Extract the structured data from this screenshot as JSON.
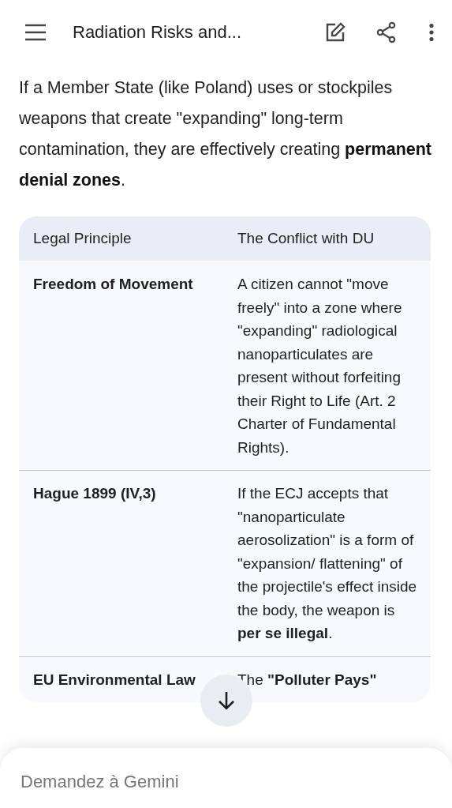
{
  "header": {
    "title": "Radiation Risks and..."
  },
  "paragraph": "If a Member State (like Poland) uses or stockpiles weapons that create \"expanding\" long-term contamination, they are effectively creating **permanent denial zones**.",
  "table": {
    "columns": [
      "Legal Principle",
      "The Conflict with DU"
    ],
    "rows": [
      {
        "cells": [
          "Freedom of Movement",
          "A citizen cannot \"move freely\" into a zone where \"expanding\" radiological nanoparticulates are present without forfeiting their Right to Life (Art. 2 Charter of Fundamental Rights)."
        ]
      },
      {
        "cells": [
          "Hague 1899 (IV,3)",
          "If the ECJ accepts that \"nanoparticulate aerosolization\" is a form of \"expansion/ flattening\" of the projectile's effect inside the body, the weapon is **per se illegal**."
        ]
      },
      {
        "cells": [
          "EU Environmental Law",
          "The **\"Polluter Pays\"**"
        ]
      }
    ]
  },
  "composer": {
    "placeholder": "Demandez à Gemini"
  }
}
